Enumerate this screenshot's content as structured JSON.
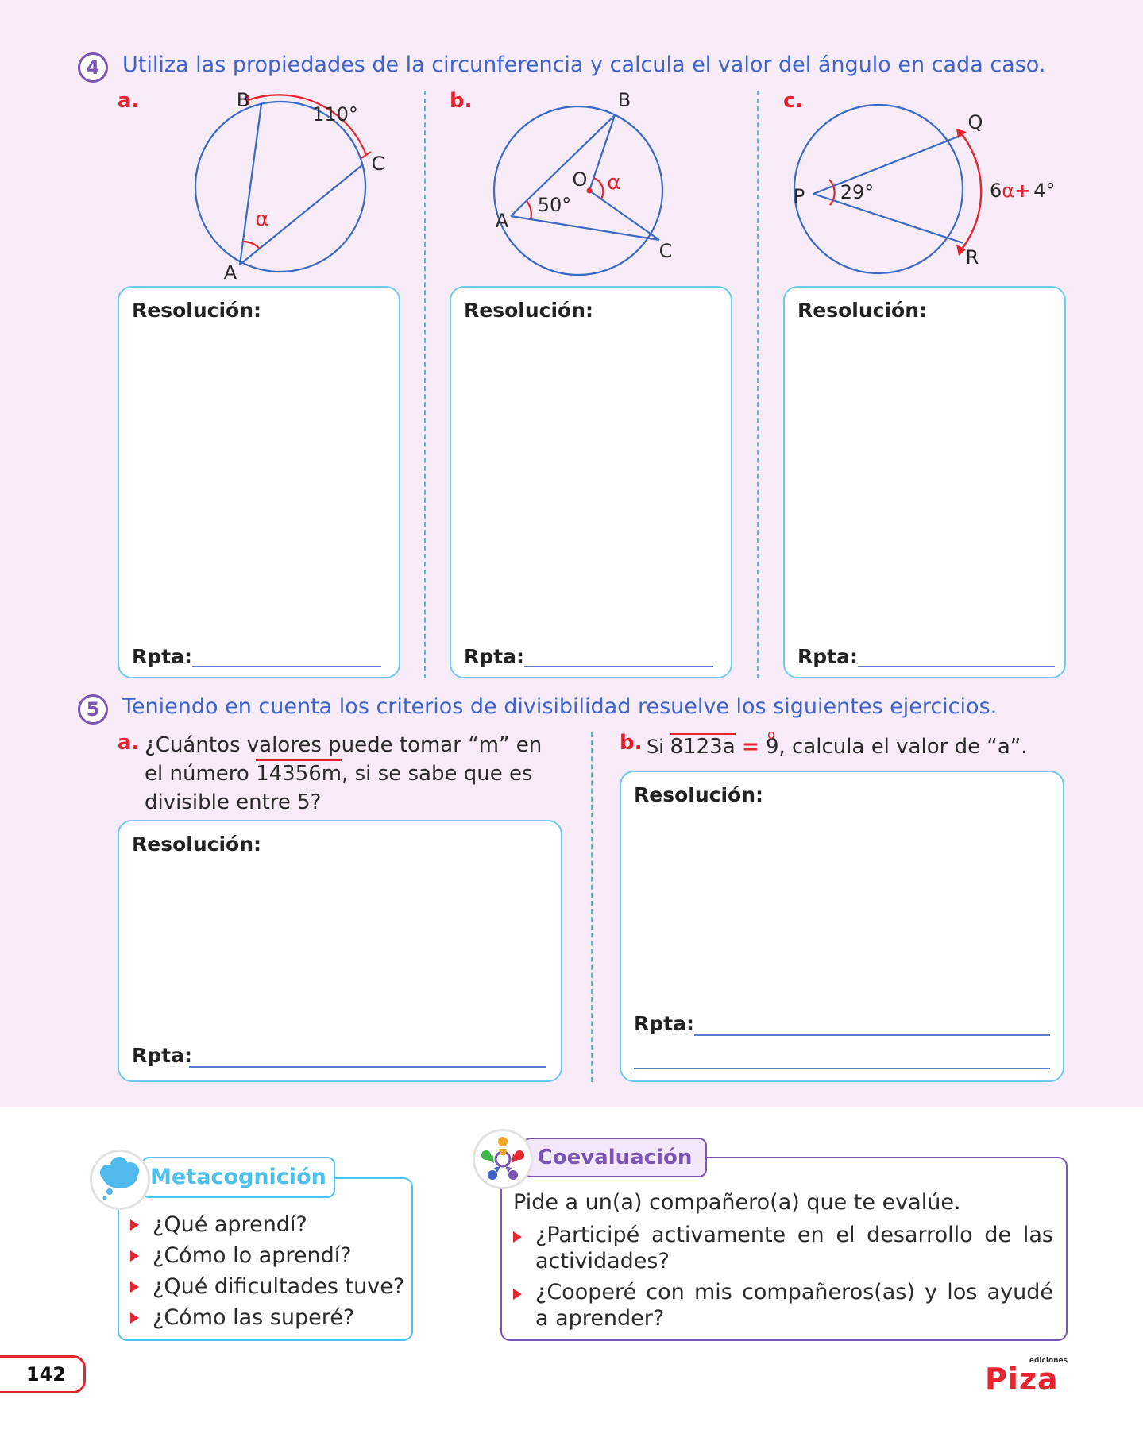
{
  "q4": {
    "number": "4",
    "instruction": "Utiliza las propiedades de la circunferencia y calcula el valor del ángulo en cada caso.",
    "parts": [
      {
        "letter": "a.",
        "labels": {
          "b": "B",
          "c": "C",
          "a": "A",
          "arc": "110°",
          "alpha": "α"
        }
      },
      {
        "letter": "b.",
        "labels": {
          "b": "B",
          "o": "O",
          "alpha": "α",
          "a": "A",
          "angle": "50°",
          "c": "C"
        }
      },
      {
        "letter": "c.",
        "labels": {
          "q": "Q",
          "p": "P",
          "angle": "29°",
          "r": "R",
          "arc_coef": "6",
          "alpha": "α",
          "plus": "+",
          "arc_const": "4°"
        }
      }
    ],
    "resolution_label": "Resolución:",
    "answer_label": "Rpta:"
  },
  "q5": {
    "number": "5",
    "instruction": "Teniendo en cuenta los criterios de divisibilidad resuelve los siguientes ejercicios.",
    "a": {
      "letter": "a.",
      "line1_pre": "¿Cuántos valores puede tomar “m” en",
      "line2_pre": "el número ",
      "number": "14356m",
      "line2_post": ", si se sabe que es",
      "line3": "divisible entre 5?"
    },
    "b": {
      "letter": "b.",
      "pre": "Si ",
      "number": "8123a",
      "equals": "=",
      "multiple": "9",
      "multiple_mark": "o",
      "post": ", calcula el valor de “a”."
    },
    "resolution_label": "Resolución:",
    "answer_label": "Rpta:"
  },
  "metacognicion": {
    "title": "Metacognición",
    "items": [
      "¿Qué aprendí?",
      "¿Cómo lo aprendí?",
      "¿Qué dificultades tuve?",
      "¿Cómo las superé?"
    ]
  },
  "coevaluacion": {
    "title": "Coevaluación",
    "intro": "Pide a un(a) compañero(a) que te evalúe.",
    "items": [
      "¿Participé activamente en el desarrollo de las actividades?",
      "¿Cooperé con mis compañeros(as) y los ayudé a aprender?"
    ]
  },
  "footer": {
    "page_number": "142",
    "logo_small": "ediciones",
    "logo": "Piza"
  },
  "colors": {
    "blue": "#3f63c9",
    "red": "#e5242f",
    "purple": "#7a55b5",
    "cyan": "#4cc1ee",
    "pink_bg": "#f7ebf7"
  }
}
